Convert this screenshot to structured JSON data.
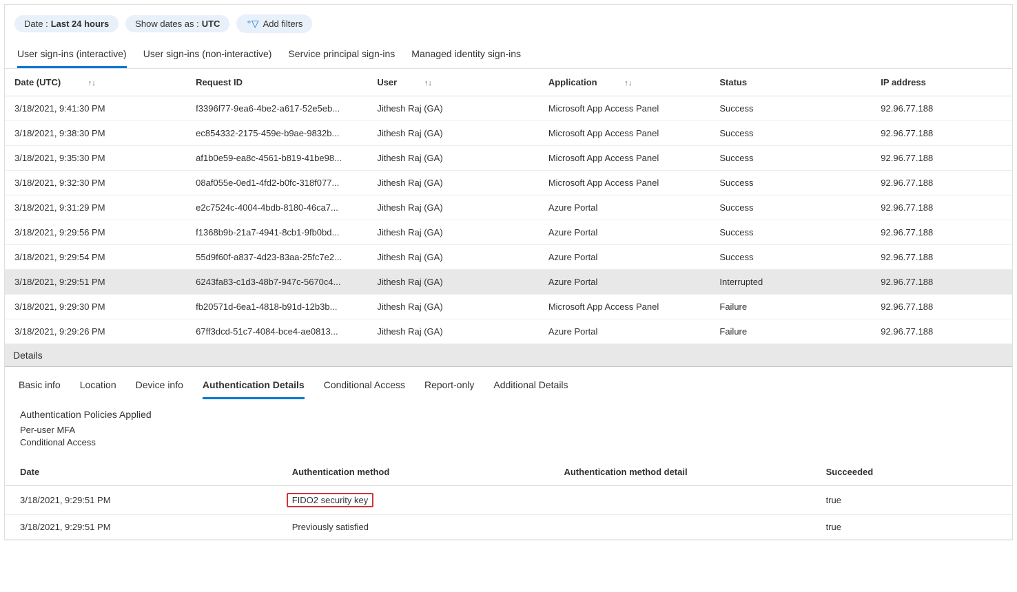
{
  "filters": {
    "date_label": "Date : ",
    "date_value": "Last 24 hours",
    "show_as_label": "Show dates as : ",
    "show_as_value": "UTC",
    "add_filters": "Add filters"
  },
  "tabs": [
    {
      "label": "User sign-ins (interactive)",
      "active": true
    },
    {
      "label": "User sign-ins (non-interactive)",
      "active": false
    },
    {
      "label": "Service principal sign-ins",
      "active": false
    },
    {
      "label": "Managed identity sign-ins",
      "active": false
    }
  ],
  "cols": {
    "date": "Date (UTC)",
    "req": "Request ID",
    "user": "User",
    "app": "Application",
    "status": "Status",
    "ip": "IP address"
  },
  "rows": [
    {
      "date": "3/18/2021, 9:41:30 PM",
      "req": "f3396f77-9ea6-4be2-a617-52e5eb...",
      "user": "Jithesh Raj (GA)",
      "app": "Microsoft App Access Panel",
      "status": "Success",
      "ip": "92.96.77.188"
    },
    {
      "date": "3/18/2021, 9:38:30 PM",
      "req": "ec854332-2175-459e-b9ae-9832b...",
      "user": "Jithesh Raj (GA)",
      "app": "Microsoft App Access Panel",
      "status": "Success",
      "ip": "92.96.77.188"
    },
    {
      "date": "3/18/2021, 9:35:30 PM",
      "req": "af1b0e59-ea8c-4561-b819-41be98...",
      "user": "Jithesh Raj (GA)",
      "app": "Microsoft App Access Panel",
      "status": "Success",
      "ip": "92.96.77.188"
    },
    {
      "date": "3/18/2021, 9:32:30 PM",
      "req": "08af055e-0ed1-4fd2-b0fc-318f077...",
      "user": "Jithesh Raj (GA)",
      "app": "Microsoft App Access Panel",
      "status": "Success",
      "ip": "92.96.77.188"
    },
    {
      "date": "3/18/2021, 9:31:29 PM",
      "req": "e2c7524c-4004-4bdb-8180-46ca7...",
      "user": "Jithesh Raj (GA)",
      "app": "Azure Portal",
      "status": "Success",
      "ip": "92.96.77.188"
    },
    {
      "date": "3/18/2021, 9:29:56 PM",
      "req": "f1368b9b-21a7-4941-8cb1-9fb0bd...",
      "user": "Jithesh Raj (GA)",
      "app": "Azure Portal",
      "status": "Success",
      "ip": "92.96.77.188"
    },
    {
      "date": "3/18/2021, 9:29:54 PM",
      "req": "55d9f60f-a837-4d23-83aa-25fc7e2...",
      "user": "Jithesh Raj (GA)",
      "app": "Azure Portal",
      "status": "Success",
      "ip": "92.96.77.188"
    },
    {
      "date": "3/18/2021, 9:29:51 PM",
      "req": "6243fa83-c1d3-48b7-947c-5670c4...",
      "user": "Jithesh Raj (GA)",
      "app": "Azure Portal",
      "status": "Interrupted",
      "ip": "92.96.77.188",
      "selected": true
    },
    {
      "date": "3/18/2021, 9:29:30 PM",
      "req": "fb20571d-6ea1-4818-b91d-12b3b...",
      "user": "Jithesh Raj (GA)",
      "app": "Microsoft App Access Panel",
      "status": "Failure",
      "ip": "92.96.77.188"
    },
    {
      "date": "3/18/2021, 9:29:26 PM",
      "req": "67ff3dcd-51c7-4084-bce4-ae0813...",
      "user": "Jithesh Raj (GA)",
      "app": "Azure Portal",
      "status": "Failure",
      "ip": "92.96.77.188"
    }
  ],
  "details": {
    "header": "Details",
    "tabs": [
      {
        "label": "Basic info"
      },
      {
        "label": "Location"
      },
      {
        "label": "Device info"
      },
      {
        "label": "Authentication Details",
        "active": true
      },
      {
        "label": "Conditional Access"
      },
      {
        "label": "Report-only"
      },
      {
        "label": "Additional Details"
      }
    ],
    "policies_title": "Authentication Policies Applied",
    "policies": [
      "Per-user MFA",
      "Conditional Access"
    ],
    "cols": {
      "date": "Date",
      "method": "Authentication method",
      "detail": "Authentication method detail",
      "succ": "Succeeded"
    },
    "rows": [
      {
        "date": "3/18/2021, 9:29:51 PM",
        "method": "FIDO2 security key",
        "detail": "",
        "succ": "true",
        "highlight": true
      },
      {
        "date": "3/18/2021, 9:29:51 PM",
        "method": "Previously satisfied",
        "detail": "",
        "succ": "true"
      }
    ]
  }
}
